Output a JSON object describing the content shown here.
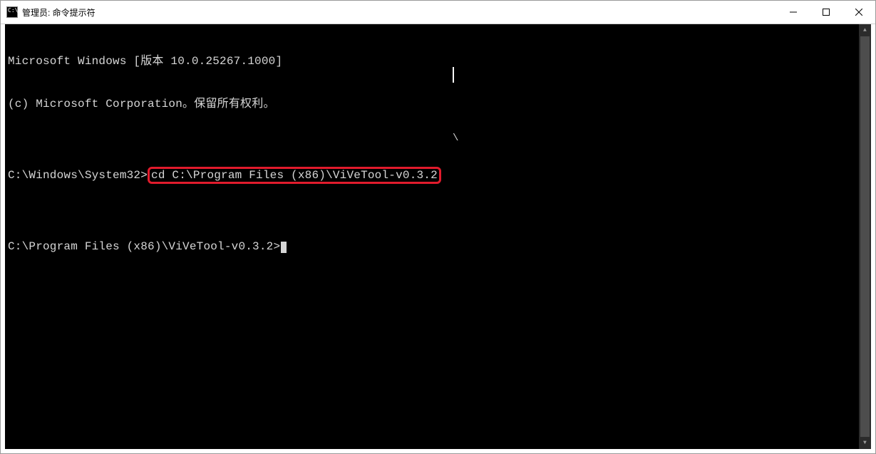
{
  "window": {
    "title": "管理员: 命令提示符"
  },
  "terminal": {
    "line1": "Microsoft Windows [版本 10.0.25267.1000]",
    "line2": "(c) Microsoft Corporation。保留所有权利。",
    "blank1": "",
    "prompt1_path": "C:\\Windows\\System32>",
    "prompt1_cmd": "cd C:\\Program Files (x86)\\ViVeTool-v0.3.2",
    "blank2": "",
    "prompt2_path": "C:\\Program Files (x86)\\ViVeTool-v0.3.2>",
    "stray": "\\"
  }
}
